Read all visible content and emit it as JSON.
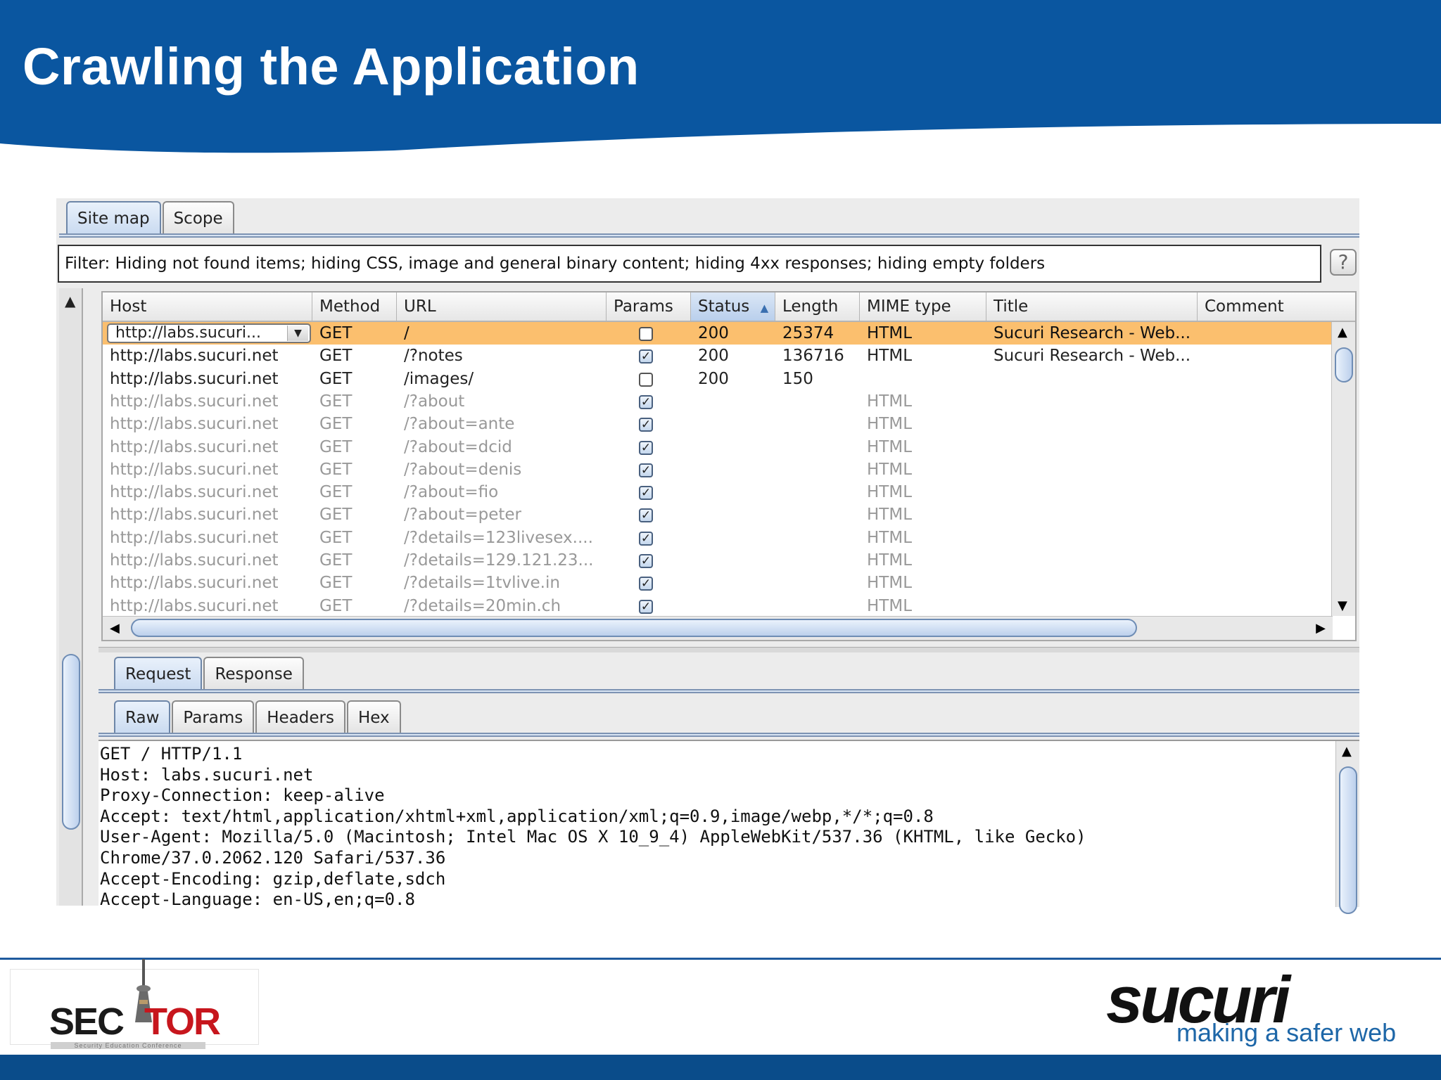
{
  "slide": {
    "title": "Crawling the Application",
    "colors": {
      "header_blue": "#0a56a0",
      "footer_blue": "#0a4c8a",
      "selected_row": "#fbbf6e"
    }
  },
  "burp": {
    "top_tabs": [
      "Site map",
      "Scope"
    ],
    "active_top_tab": "Site map",
    "filter_text": "Filter: Hiding not found items;  hiding CSS, image and general binary content;  hiding 4xx responses;  hiding empty folders",
    "help_label": "?",
    "columns": [
      "Host",
      "Method",
      "URL",
      "Params",
      "Status",
      "Length",
      "MIME type",
      "Title",
      "Comment"
    ],
    "sorted_column": "Status",
    "sort_indicator": "▲",
    "host_combo": "http://labs.sucuri...",
    "rows": [
      {
        "host": "http://labs.sucuri.net",
        "method": "GET",
        "url": "/",
        "params": false,
        "status": "200",
        "length": "25374",
        "mime": "HTML",
        "title": "Sucuri Research - Web...",
        "comment": ""
      },
      {
        "host": "http://labs.sucuri.net",
        "method": "GET",
        "url": "/?notes",
        "params": true,
        "status": "200",
        "length": "136716",
        "mime": "HTML",
        "title": "Sucuri Research - Web...",
        "comment": ""
      },
      {
        "host": "http://labs.sucuri.net",
        "method": "GET",
        "url": "/images/",
        "params": false,
        "status": "200",
        "length": "150",
        "mime": "",
        "title": "",
        "comment": ""
      },
      {
        "host": "http://labs.sucuri.net",
        "method": "GET",
        "url": "/?about",
        "params": true,
        "status": "",
        "length": "",
        "mime": "HTML",
        "title": "",
        "comment": ""
      },
      {
        "host": "http://labs.sucuri.net",
        "method": "GET",
        "url": "/?about=ante",
        "params": true,
        "status": "",
        "length": "",
        "mime": "HTML",
        "title": "",
        "comment": ""
      },
      {
        "host": "http://labs.sucuri.net",
        "method": "GET",
        "url": "/?about=dcid",
        "params": true,
        "status": "",
        "length": "",
        "mime": "HTML",
        "title": "",
        "comment": ""
      },
      {
        "host": "http://labs.sucuri.net",
        "method": "GET",
        "url": "/?about=denis",
        "params": true,
        "status": "",
        "length": "",
        "mime": "HTML",
        "title": "",
        "comment": ""
      },
      {
        "host": "http://labs.sucuri.net",
        "method": "GET",
        "url": "/?about=fio",
        "params": true,
        "status": "",
        "length": "",
        "mime": "HTML",
        "title": "",
        "comment": ""
      },
      {
        "host": "http://labs.sucuri.net",
        "method": "GET",
        "url": "/?about=peter",
        "params": true,
        "status": "",
        "length": "",
        "mime": "HTML",
        "title": "",
        "comment": ""
      },
      {
        "host": "http://labs.sucuri.net",
        "method": "GET",
        "url": "/?details=123livesex....",
        "params": true,
        "status": "",
        "length": "",
        "mime": "HTML",
        "title": "",
        "comment": ""
      },
      {
        "host": "http://labs.sucuri.net",
        "method": "GET",
        "url": "/?details=129.121.23...",
        "params": true,
        "status": "",
        "length": "",
        "mime": "HTML",
        "title": "",
        "comment": ""
      },
      {
        "host": "http://labs.sucuri.net",
        "method": "GET",
        "url": "/?details=1tvlive.in",
        "params": true,
        "status": "",
        "length": "",
        "mime": "HTML",
        "title": "",
        "comment": ""
      },
      {
        "host": "http://labs.sucuri.net",
        "method": "GET",
        "url": "/?details=20min.ch",
        "params": true,
        "status": "",
        "length": "",
        "mime": "HTML",
        "title": "",
        "comment": ""
      }
    ],
    "selected_row": 0,
    "message_tabs": [
      "Request",
      "Response"
    ],
    "active_message_tab": "Request",
    "view_tabs": [
      "Raw",
      "Params",
      "Headers",
      "Hex"
    ],
    "active_view_tab": "Raw",
    "raw_request": [
      "GET / HTTP/1.1",
      "Host: labs.sucuri.net",
      "Proxy-Connection: keep-alive",
      "Accept: text/html,application/xhtml+xml,application/xml;q=0.9,image/webp,*/*;q=0.8",
      "User-Agent: Mozilla/5.0 (Macintosh; Intel Mac OS X 10_9_4) AppleWebKit/537.36 (KHTML, like Gecko)",
      "Chrome/37.0.2062.120 Safari/537.36",
      "Accept-Encoding: gzip,deflate,sdch",
      "Accept-Language: en-US,en;q=0.8"
    ]
  },
  "footer": {
    "sector_logo_a": "SEC",
    "sector_logo_b": "TOR",
    "sector_subtitle": "Security Education Conference",
    "sucuri_logo": "sucuri",
    "sucuri_tagline": "making a safer web"
  }
}
